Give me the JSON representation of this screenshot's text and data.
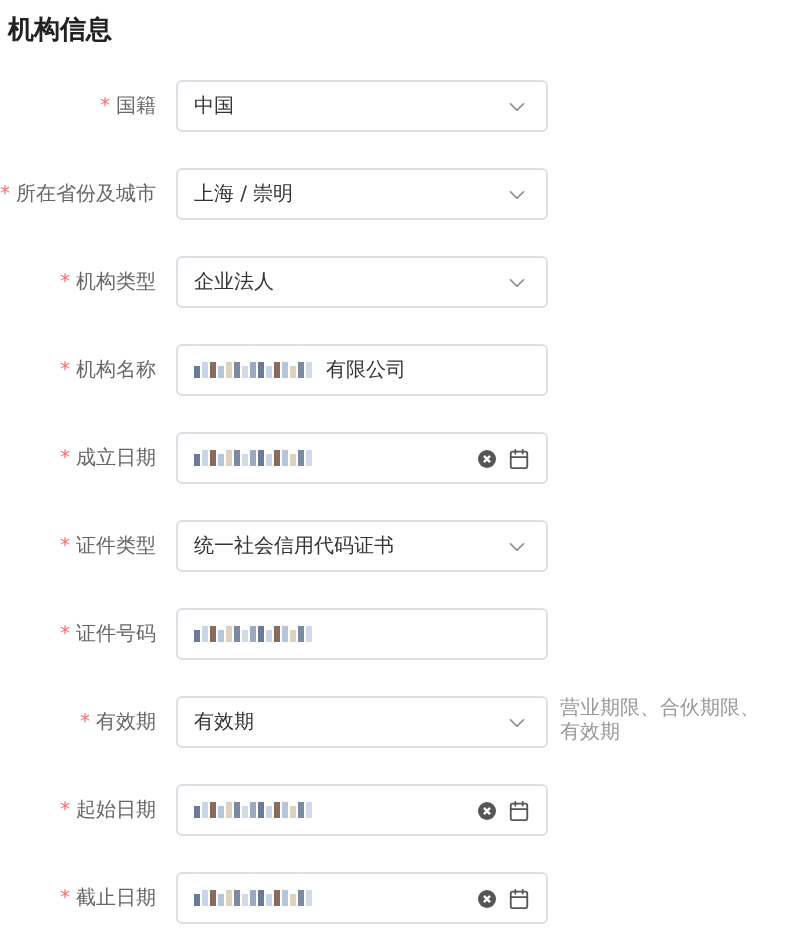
{
  "section_title": "机构信息",
  "fields": [
    {
      "label": "国籍",
      "required_mark": "*",
      "kind": "select",
      "value": "中国"
    },
    {
      "label": "所在省份及城市",
      "required_mark": "*",
      "kind": "select",
      "value": "上海 / 崇明"
    },
    {
      "label": "机构类型",
      "required_mark": "*",
      "kind": "select",
      "value": "企业法人"
    },
    {
      "label": "机构名称",
      "required_mark": "*",
      "kind": "text",
      "redacted": true,
      "value": "有限公司"
    },
    {
      "label": "成立日期",
      "required_mark": "*",
      "kind": "date",
      "redacted": true
    },
    {
      "label": "证件类型",
      "required_mark": "*",
      "kind": "select",
      "value": "统一社会信用代码证书"
    },
    {
      "label": "证件号码",
      "required_mark": "*",
      "kind": "text",
      "redacted": true
    },
    {
      "label": "有效期",
      "required_mark": "*",
      "kind": "select",
      "value": "有效期",
      "hint": "营业期限、合伙期限、有效期"
    },
    {
      "label": "起始日期",
      "required_mark": "*",
      "kind": "date",
      "redacted": true
    },
    {
      "label": "截止日期",
      "required_mark": "*",
      "kind": "date",
      "redacted": true
    }
  ]
}
